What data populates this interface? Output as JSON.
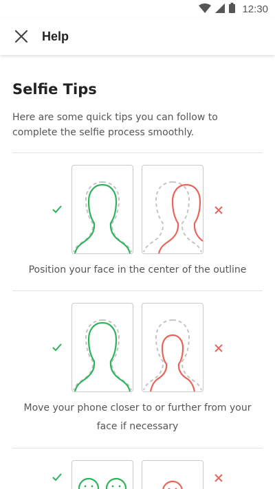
{
  "status_bar": {
    "time": "12:30",
    "icons": [
      "wifi-icon",
      "cell-signal-icon",
      "battery-icon"
    ]
  },
  "app_bar": {
    "close_icon": "close-icon",
    "title": "Help"
  },
  "page": {
    "heading": "Selfie Tips",
    "intro": "Here are some quick tips you can follow to complete the selfie process smoothly.",
    "tips": [
      {
        "caption": "Position your face in the center of the outline",
        "good_icon": "check-icon",
        "bad_icon": "cross-icon"
      },
      {
        "caption": "Move your phone closer to or further from your face if necessary",
        "good_icon": "check-icon",
        "bad_icon": "cross-icon"
      },
      {
        "caption": "",
        "good_icon": "check-icon",
        "bad_icon": "cross-icon"
      }
    ]
  },
  "colors": {
    "good": "#2db35c",
    "bad": "#e8645a",
    "outline_dashed": "#c4c4c4",
    "text": "#555555",
    "heading": "#222222"
  }
}
